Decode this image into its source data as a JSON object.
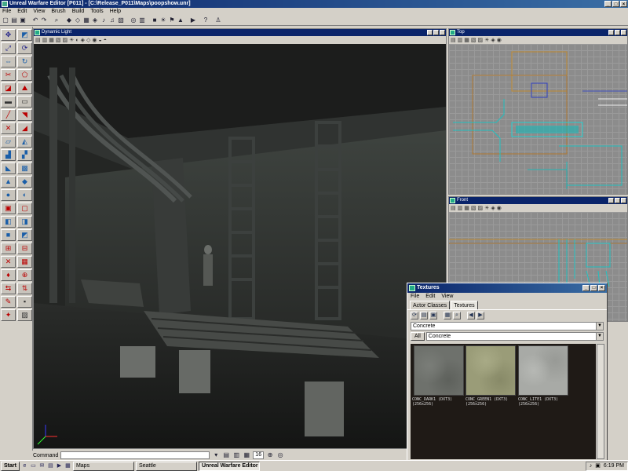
{
  "app": {
    "title": "Unreal Warfare Editor [P011] - [C:\\Release_P011\\Maps\\poopshow.unr]",
    "window_buttons": [
      "_",
      "□",
      "×"
    ]
  },
  "menu": [
    "File",
    "Edit",
    "View",
    "Brush",
    "Build",
    "Tools",
    "Help"
  ],
  "viewports": {
    "main": {
      "title": "Dynamic Light"
    },
    "top": {
      "title": "Top"
    },
    "front": {
      "title": "Front"
    }
  },
  "textures": {
    "title": "Textures",
    "menu": [
      "File",
      "Edit",
      "View"
    ],
    "tabs": [
      "Actor Classes",
      "Textures"
    ],
    "package": "Concrete",
    "group_button": "All",
    "group": "Concrete",
    "items": [
      {
        "name": "CONC_DARK1 (DXT3)",
        "size": "(256x256)",
        "color": "#6e716c"
      },
      {
        "name": "CONC_GREEN1 (DXT3)",
        "size": "(256x256)",
        "color": "#9a9c78"
      },
      {
        "name": "CONC_LITE1 (DXT3)",
        "size": "(256x256)",
        "color": "#a8aaa6"
      }
    ]
  },
  "statusbar": {
    "command_label": "Command",
    "grid_label": "16"
  },
  "taskbar": {
    "start": "Start",
    "tasks": [
      "Maps",
      "Seattle",
      "Unreal Warfare Editor ..."
    ],
    "clock": "6:19 PM"
  }
}
